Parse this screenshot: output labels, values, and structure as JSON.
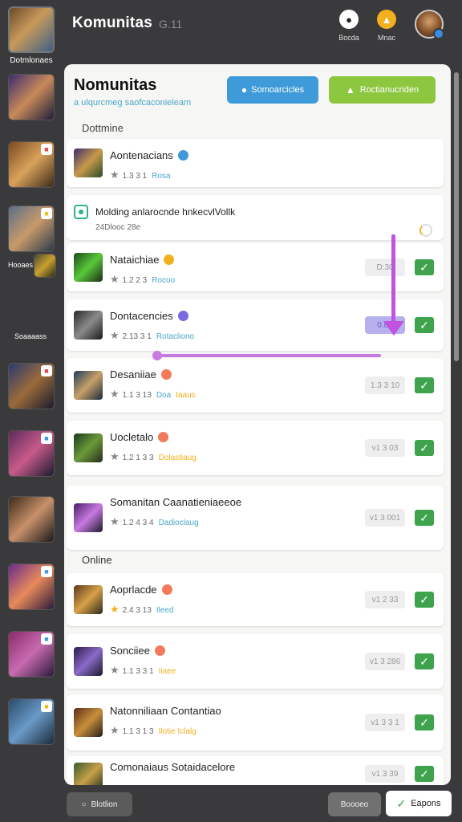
{
  "app": {
    "title": "Komunitas",
    "title_suffix": "G.11"
  },
  "top_actions": [
    {
      "label": "Bocda",
      "icon": "bell-icon",
      "color": "#ffffff"
    },
    {
      "label": "Mnac",
      "icon": "alert-icon",
      "color": "#f2b01e"
    }
  ],
  "sidebar": {
    "header": "Dotmlonaes",
    "mid_label": "Hooaes",
    "item_caption": "Soaaaass",
    "items": [
      {
        "gradient": "linear-gradient(135deg,#3b2a6e,#c88a5a 50%,#1d1d3a)",
        "badge": ""
      },
      {
        "gradient": "linear-gradient(135deg,#7a4a20,#d9a25a 50%,#3b2a1a)",
        "badge": "■",
        "badge_color": "#e04848"
      },
      {
        "gradient": "linear-gradient(135deg,#5a6e8a,#c89a6a 50%,#2a3a4a)",
        "badge": "■",
        "badge_color": "#e8c020"
      },
      {
        "gradient": "linear-gradient(135deg,#4a4a30,#c8a030 50%,#2a2a1a)",
        "badge": ""
      },
      {
        "gradient": "linear-gradient(135deg,#2a3a6e,#9a6a3a 50%,#1a1a2e)",
        "badge": "■",
        "badge_color": "#e04848"
      },
      {
        "gradient": "linear-gradient(135deg,#5a2a5a,#c85a8a 50%,#1a1a2e)",
        "badge": "■",
        "badge_color": "#3e9ad8"
      },
      {
        "gradient": "linear-gradient(135deg,#3a2a1a,#c8906a 50%,#1a1a1a)",
        "badge": ""
      },
      {
        "gradient": "linear-gradient(135deg,#6a2a8a,#e88a5a 50%,#2a1a3a)",
        "badge": "■",
        "badge_color": "#3e9ad8"
      },
      {
        "gradient": "linear-gradient(135deg,#8a2a6a,#c86ab0 50%,#2a1a3a)",
        "badge": "■",
        "badge_color": "#3e9ad8"
      },
      {
        "gradient": "linear-gradient(135deg,#2a4a6a,#6a9ac8 50%,#1a2a3a)",
        "badge": "■",
        "badge_color": "#e8c020"
      }
    ]
  },
  "panel": {
    "title": "Nomunitas",
    "subtitle": "a ulqurcmeg saofcaconieleam",
    "btn_blue": "Somoarcicles",
    "btn_green": "Roctianucriden",
    "section_top": "Dottmine",
    "section_online": "Online"
  },
  "notice": {
    "text": "Molding anlarocnde hnkecvlVollk",
    "sub": "24Dlooc 28e"
  },
  "rows_top": [
    {
      "name": "Aontenacians",
      "emoji_color": "#3e9ad8",
      "rating": "1.3 3 1",
      "tag": "Rosa",
      "tag_color": "#4aa7c9",
      "value": "",
      "checked": false,
      "thumb": "linear-gradient(135deg,#3a2a6e,#c89a4a 50%,#2a4a2a)"
    },
    {
      "name": "Nataichiae",
      "emoji_color": "#f2b01e",
      "rating": "1.2 2 3",
      "tag": "Rocoo",
      "tag_color": "#4aa7c9",
      "value": "D:30",
      "checked": true,
      "thumb": "linear-gradient(135deg,#1a4a1a,#5ac83a 50%,#1a2a1a)"
    },
    {
      "name": "Dontacencies",
      "emoji_color": "#7a6ae0",
      "rating": "2.13 3 1",
      "tag": "Rotacliono",
      "tag_color": "#4aa7c9",
      "value": "0.80",
      "value_active": true,
      "checked": true,
      "thumb": "linear-gradient(135deg,#2a2a2a,#8a8a8a 50%,#1a1a1a)"
    },
    {
      "name": "Desaniiae",
      "emoji_color": "#f27a5a",
      "rating": "1.1 3 13",
      "tag": "Doa",
      "tag2": "Iaaus",
      "tag_color": "#4aa7c9",
      "tag2_color": "#f2b01e",
      "value": "1.3 3 10",
      "checked": true,
      "thumb": "linear-gradient(135deg,#1a3a5a,#c8a06a 50%,#1a2a3a)"
    },
    {
      "name": "Uocletalo",
      "emoji_color": "#f27a5a",
      "rating": "1.2 1 3 3",
      "tag": "Dolastiaug",
      "tag_color": "#f2b01e",
      "value": "v1 3 03",
      "checked": true,
      "thumb": "linear-gradient(135deg,#1a3a1a,#6a9a3a 50%,#2a2a1a)"
    },
    {
      "name": "Somanitan Caanatieniaeeoe",
      "emoji_color": "",
      "rating": "1.2 4 3 4",
      "tag": "Dadioclaug",
      "tag_color": "#4aa7c9",
      "value": "v1 3 001",
      "checked": true,
      "thumb": "linear-gradient(135deg,#4a1a6a,#c87ae0 50%,#1a1a2a)"
    }
  ],
  "rows_online": [
    {
      "name": "Aoprlacde",
      "emoji_color": "#f27a5a",
      "rating": "2.4 3 13",
      "tag": "Ileed",
      "tag_color": "#4aa7c9",
      "value": "v1 2 33",
      "checked": true,
      "gold_star": true,
      "thumb": "linear-gradient(135deg,#5a3a1a,#d8a04a 50%,#2a2a1a)"
    },
    {
      "name": "Sonciiee",
      "emoji_color": "#f27a5a",
      "rating": "1.1 3 3 1",
      "tag": "Iiaee",
      "tag_color": "#f2b01e",
      "value": "v1 3 286",
      "checked": true,
      "thumb": "linear-gradient(135deg,#2a1a4a,#8a6ac8 50%,#1a1a2a)"
    },
    {
      "name": "Natonniliaan Contantiao",
      "emoji_color": "",
      "rating": "1.1 3 1 3",
      "tag": "Ilotie Iclalg",
      "tag_color": "#f2b01e",
      "value": "v1 3 3 1",
      "checked": true,
      "thumb": "linear-gradient(135deg,#5a2a1a,#c8903a 50%,#2a1a1a)"
    },
    {
      "name": "Comonaiaus Sotaidacelore",
      "emoji_color": "",
      "rating": "",
      "tag": "",
      "value": "v1 3 39",
      "checked": true,
      "thumb": "linear-gradient(135deg,#3a5a2a,#c8a04a 50%,#1a2a1a)"
    }
  ],
  "bottom": {
    "left": "Blotlion",
    "mid": "Boooeo",
    "right": "Eapons"
  }
}
